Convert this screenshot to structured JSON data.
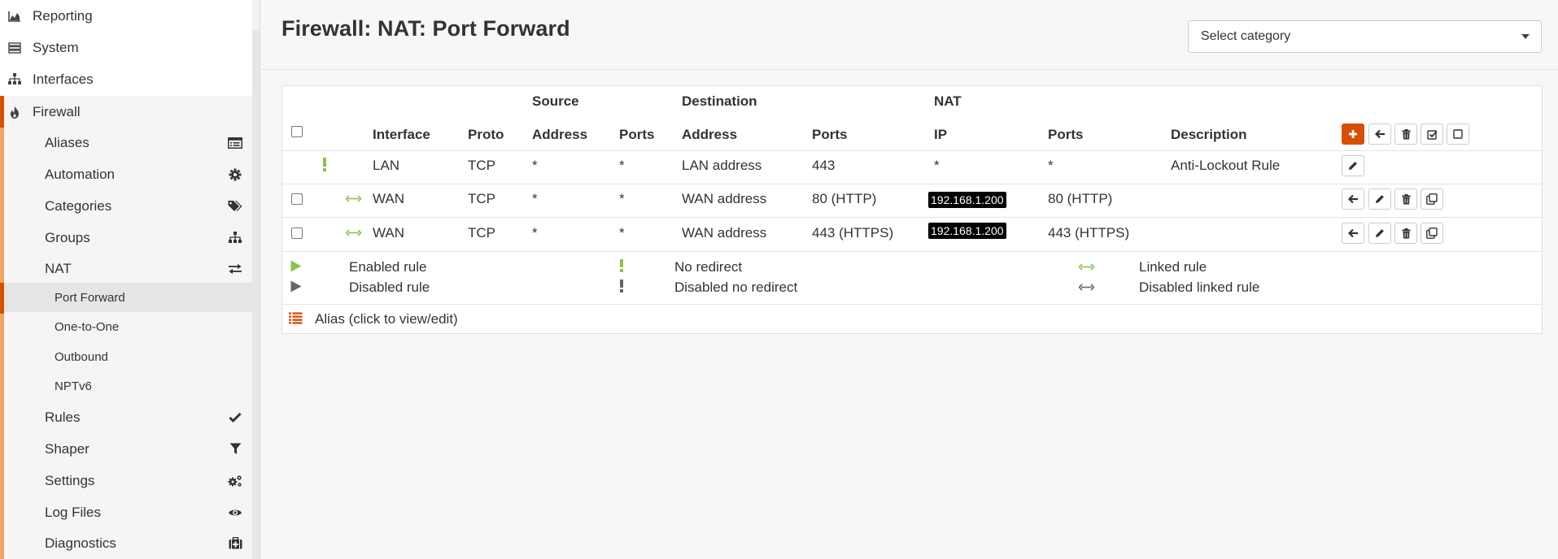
{
  "sidebar": {
    "top_items": [
      {
        "label": "Reporting",
        "icon": "area-chart-icon"
      },
      {
        "label": "System",
        "icon": "server-icon"
      },
      {
        "label": "Interfaces",
        "icon": "sitemap-icon"
      },
      {
        "label": "Firewall",
        "icon": "fire-icon"
      }
    ],
    "firewall_items": [
      {
        "label": "Aliases",
        "icon": "list-alt-icon"
      },
      {
        "label": "Automation",
        "icon": "gear-icon"
      },
      {
        "label": "Categories",
        "icon": "tags-icon"
      },
      {
        "label": "Groups",
        "icon": "sitemap-icon"
      },
      {
        "label": "NAT",
        "icon": "exchange-icon"
      },
      {
        "label": "Rules",
        "icon": "check-icon"
      },
      {
        "label": "Shaper",
        "icon": "filter-icon"
      },
      {
        "label": "Settings",
        "icon": "gears-icon"
      },
      {
        "label": "Log Files",
        "icon": "eye-icon"
      },
      {
        "label": "Diagnostics",
        "icon": "medkit-icon"
      }
    ],
    "nat_items": [
      {
        "label": "Port Forward",
        "active": true
      },
      {
        "label": "One-to-One",
        "active": false
      },
      {
        "label": "Outbound",
        "active": false
      },
      {
        "label": "NPTv6",
        "active": false
      }
    ]
  },
  "page": {
    "title": "Firewall: NAT: Port Forward",
    "category_placeholder": "Select category"
  },
  "table": {
    "group_headers": {
      "source": "Source",
      "destination": "Destination",
      "nat": "NAT"
    },
    "columns": {
      "interface": "Interface",
      "proto": "Proto",
      "src_address": "Address",
      "src_ports": "Ports",
      "dst_address": "Address",
      "dst_ports": "Ports",
      "nat_ip": "IP",
      "nat_ports": "Ports",
      "description": "Description"
    },
    "rows": [
      {
        "interface": "LAN",
        "proto": "TCP",
        "src_address": "*",
        "src_ports": "*",
        "dst_address": "LAN address",
        "dst_ports": "443",
        "nat_ip": "*",
        "nat_ports": "*",
        "description": "Anti-Lockout Rule"
      },
      {
        "interface": "WAN",
        "proto": "TCP",
        "src_address": "*",
        "src_ports": "*",
        "dst_address": "WAN address",
        "dst_ports": "80 (HTTP)",
        "nat_ip": "192.168.1.200",
        "nat_ports": "80 (HTTP)",
        "description": ""
      },
      {
        "interface": "WAN",
        "proto": "TCP",
        "src_address": "*",
        "src_ports": "*",
        "dst_address": "WAN address",
        "dst_ports": "443 (HTTPS)",
        "nat_ip": "192.168.1.200",
        "nat_ports": "443 (HTTPS)",
        "description": ""
      }
    ]
  },
  "legend": {
    "enabled_rule": "Enabled rule",
    "disabled_rule": "Disabled rule",
    "no_redirect": "No redirect",
    "disabled_no_redirect": "Disabled no redirect",
    "linked_rule": "Linked rule",
    "disabled_linked_rule": "Disabled linked rule",
    "alias": "Alias (click to view/edit)"
  },
  "colors": {
    "accent": "#d94f00",
    "accent_light": "#f0a563",
    "status_green": "#8bc34a",
    "status_grey": "#666666"
  }
}
